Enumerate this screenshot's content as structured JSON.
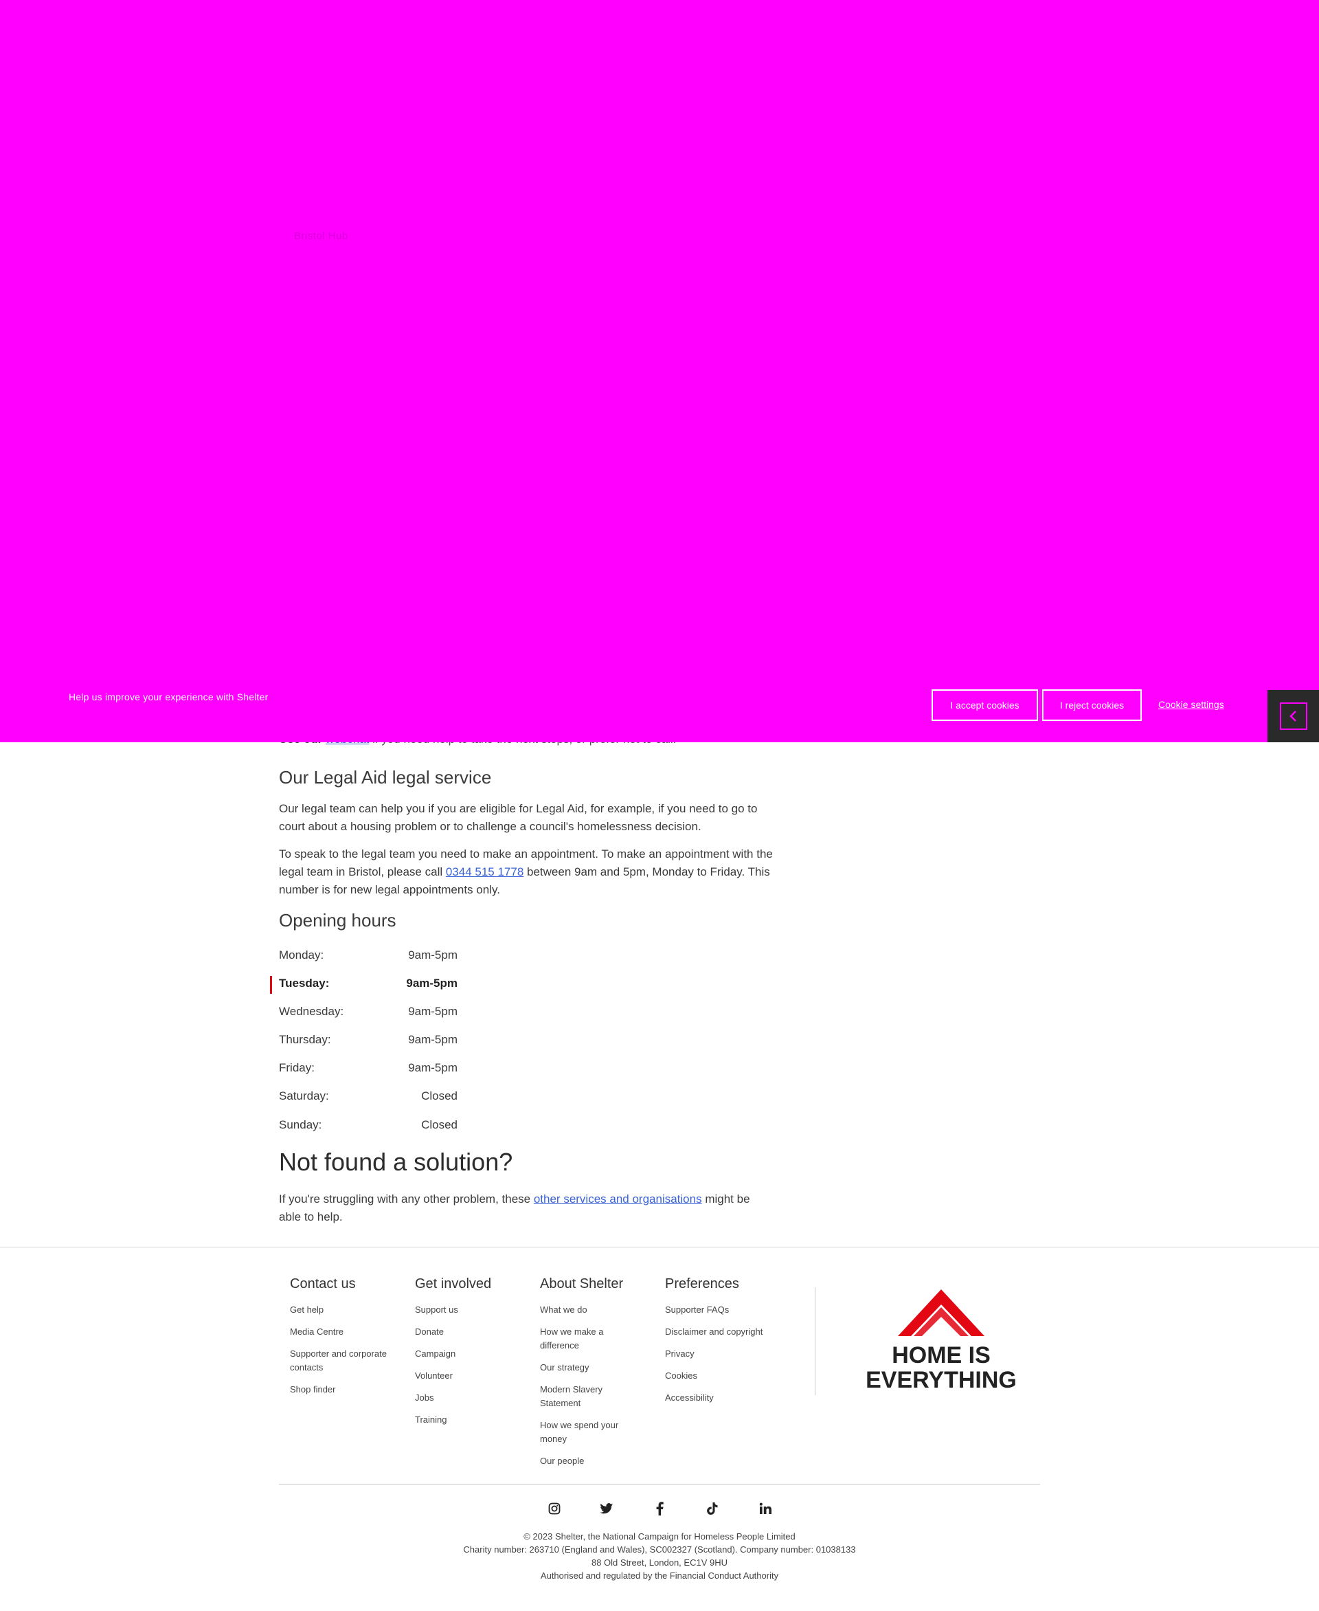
{
  "overlay": {
    "faint_texts": [
      "Bristol Hub"
    ]
  },
  "cookie_banner": {
    "message": "Help us improve your experience with Shelter",
    "accept_label": "I accept cookies",
    "reject_label": "I reject cookies",
    "settings_label": "Cookie settings"
  },
  "webchat": {
    "prefix": "Use our",
    "link": "webchat",
    "suffix": " if you need help to take the next steps, or prefer not to call."
  },
  "legal_aid": {
    "heading": "Our Legal Aid legal service",
    "para1": "Our legal team can help you if you are eligible for Legal Aid, for example, if you need to go to court about a housing problem or to challenge a council's homelessness decision.",
    "para2_before": "To speak to the legal team you need to make an appointment. To make an appointment with the legal team in Bristol, please call ",
    "phone": "0344 515 1778",
    "para2_after": " between 9am and 5pm, Monday to Friday. This number is for new legal appointments only."
  },
  "opening_hours": {
    "heading": "Opening hours",
    "rows": [
      {
        "day": "Monday:",
        "time": "9am-5pm"
      },
      {
        "day": "Tuesday:",
        "time": "9am-5pm"
      },
      {
        "day": "Wednesday:",
        "time": "9am-5pm"
      },
      {
        "day": "Thursday:",
        "time": "9am-5pm"
      },
      {
        "day": "Friday:",
        "time": "9am-5pm"
      },
      {
        "day": "Saturday:",
        "time": "Closed"
      },
      {
        "day": "Sunday:",
        "time": "Closed"
      }
    ]
  },
  "not_found": {
    "heading": "Not found a solution?",
    "before": "If you're struggling with any other problem, these ",
    "link": "other services and organisations",
    "after": " might be able to help."
  },
  "footer": {
    "columns": [
      {
        "title": "Contact us",
        "links": [
          "Get help",
          "Media Centre",
          "Supporter and corporate contacts",
          "Shop finder"
        ]
      },
      {
        "title": "Get involved",
        "links": [
          "Support us",
          "Donate",
          "Campaign",
          "Volunteer",
          "Jobs",
          "Training"
        ]
      },
      {
        "title": "About Shelter",
        "links": [
          "What we do",
          "How we make a difference",
          "Our strategy",
          "Modern Slavery Statement",
          "How we spend your money",
          "Our people"
        ]
      },
      {
        "title": "Preferences",
        "links": [
          "Supporter FAQs",
          "Disclaimer and copyright",
          "Privacy",
          "Cookies",
          "Accessibility"
        ]
      }
    ],
    "logo_line1": "HOME IS",
    "logo_line2": "EVERYTHING",
    "social": [
      "instagram-icon",
      "twitter-icon",
      "facebook-icon",
      "tiktok-icon",
      "linkedin-icon"
    ],
    "legal": [
      "© 2023 Shelter, the National Campaign for Homeless People Limited",
      "Charity number: 263710 (England and Wales), SC002327 (Scotland). Company number: 01038133",
      "88 Old Street, London, EC1V 9HU",
      "Authorised and regulated by the Financial Conduct Authority"
    ]
  },
  "colors": {
    "overlay": "#ff00ff",
    "link": "#3a63d6",
    "brand_red": "#e30613",
    "side_tab": "#2a2a2a"
  }
}
